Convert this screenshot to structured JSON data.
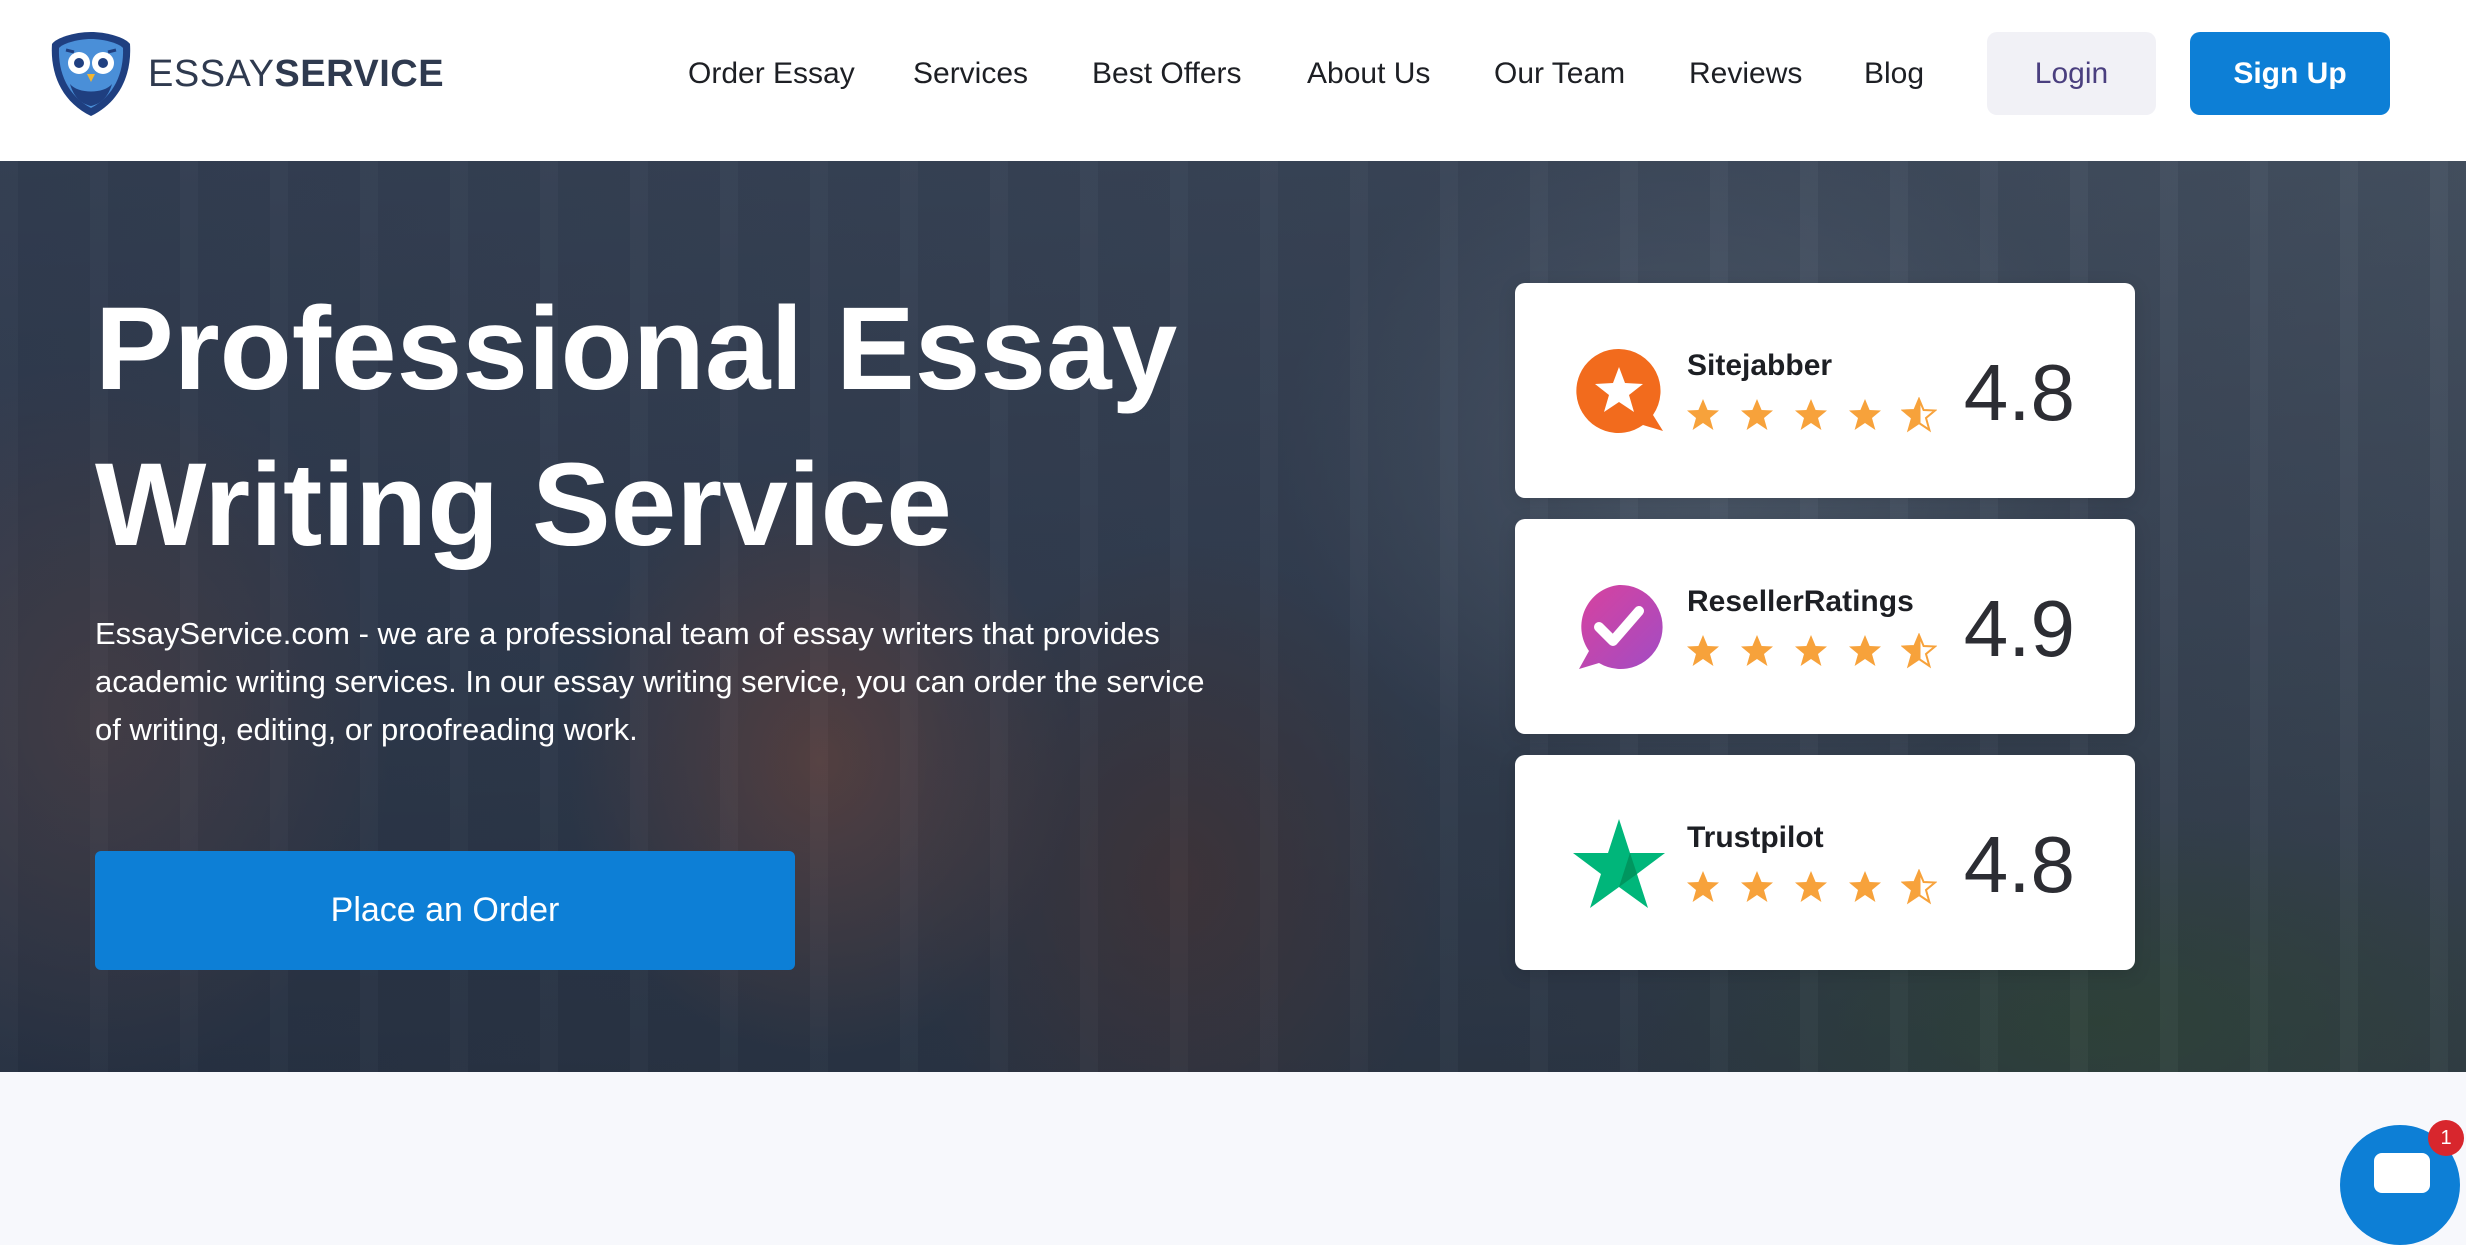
{
  "header": {
    "logo": {
      "text_light": "ESSAY",
      "text_bold": "SERVICE",
      "icon": "owl-shield-logo"
    },
    "nav": [
      {
        "label": "Order Essay"
      },
      {
        "label": "Services"
      },
      {
        "label": "Best Offers"
      },
      {
        "label": "About Us"
      },
      {
        "label": "Our Team"
      },
      {
        "label": "Reviews"
      },
      {
        "label": "Blog"
      }
    ],
    "login_label": "Login",
    "signup_label": "Sign Up"
  },
  "hero": {
    "title_line1": "Professional Essay",
    "title_line2": "Writing Service",
    "description": "EssayService.com - we are a professional team of essay writers that provides academic writing services. In our essay writing service, you can order the service of writing, editing, or proofreading work.",
    "cta_label": "Place an Order",
    "ratings": [
      {
        "name": "Sitejabber",
        "score": "4.8",
        "icon": "sitejabber-star-bubble-icon",
        "color": "#f26b1d",
        "stars": 4.8
      },
      {
        "name": "ResellerRatings",
        "score": "4.9",
        "icon": "resellerratings-check-bubble-icon",
        "color": "#c34fb0",
        "stars": 4.9
      },
      {
        "name": "Trustpilot",
        "score": "4.8",
        "icon": "trustpilot-star-icon",
        "color": "#00b67a",
        "stars": 4.8
      }
    ]
  },
  "colors": {
    "primary": "#0d7fd6",
    "star": "#f7a23b",
    "login_bg": "#f1f1f6",
    "login_text": "#4a3f7f"
  },
  "chat": {
    "badge_count": "1",
    "icon": "chat-icon"
  }
}
